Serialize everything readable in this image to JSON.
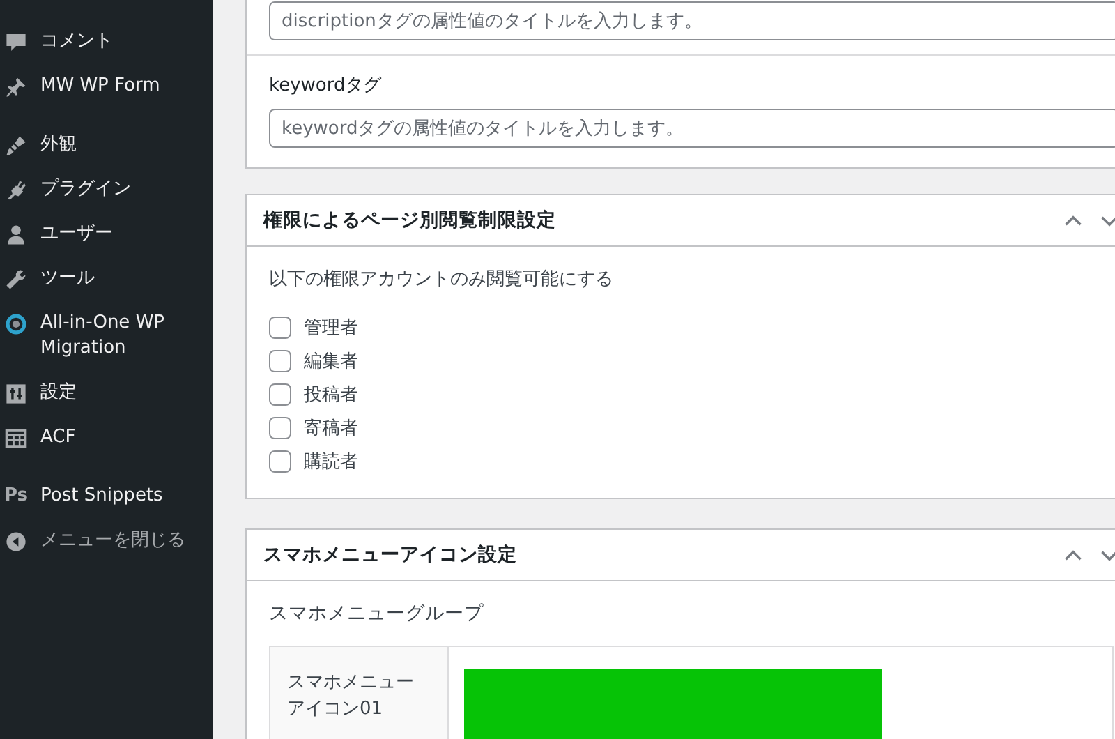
{
  "sidebar": {
    "items": [
      {
        "label": "コメント"
      },
      {
        "label": "MW WP Form"
      },
      {
        "label": "外観"
      },
      {
        "label": "プラグイン"
      },
      {
        "label": "ユーザー"
      },
      {
        "label": "ツール"
      },
      {
        "label": "All-in-One WP Migration"
      },
      {
        "label": "設定"
      },
      {
        "label": "ACF"
      },
      {
        "label": "Post Snippets",
        "icon_text": "Ps"
      },
      {
        "label": "メニューを閉じる",
        "kind": "collapse"
      }
    ]
  },
  "seo_panel": {
    "fields": [
      {
        "placeholder": "discriptionタグの属性値のタイトルを入力します。"
      },
      {
        "label": "keywordタグ",
        "placeholder": "keywordタグの属性値のタイトルを入力します。"
      }
    ]
  },
  "access_panel": {
    "title": "権限によるページ別閲覧制限設定",
    "description": "以下の権限アカウントのみ閲覧可能にする",
    "roles": [
      {
        "label": "管理者",
        "checked": false
      },
      {
        "label": "編集者",
        "checked": false
      },
      {
        "label": "投稿者",
        "checked": false
      },
      {
        "label": "寄稿者",
        "checked": false
      },
      {
        "label": "購読者",
        "checked": false
      }
    ]
  },
  "menu_icon_panel": {
    "title": "スマホメニューアイコン設定",
    "group_label": "スマホメニューグループ",
    "rows": [
      {
        "label": "スマホメニューアイコン01"
      }
    ]
  }
}
